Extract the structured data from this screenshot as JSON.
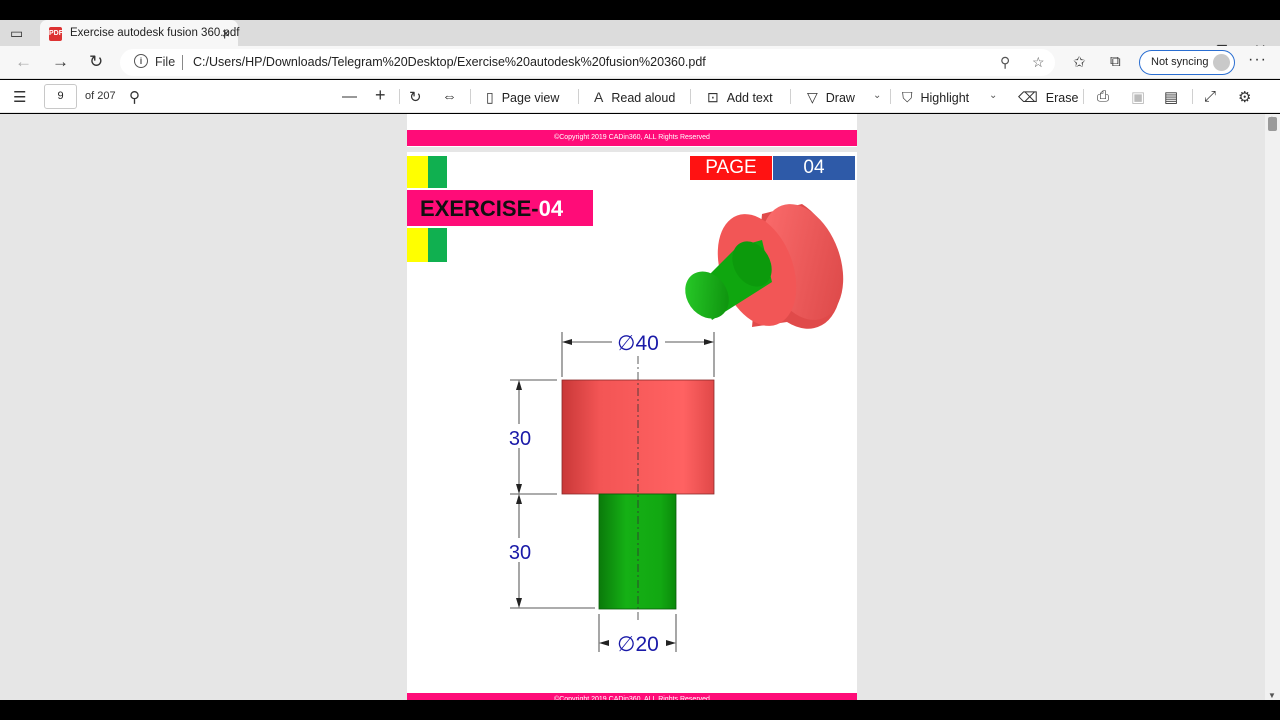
{
  "browser": {
    "tab_title": "Exercise autodesk fusion 360.pdf",
    "tab_favicon": "PDF",
    "file_label": "File",
    "url": "C:/Users/HP/Downloads/Telegram%20Desktop/Exercise%20autodesk%20fusion%20360.pdf",
    "sync_label": "Not syncing"
  },
  "pdf_toolbar": {
    "page_number": "9",
    "page_total": "of 207",
    "page_view": "Page view",
    "read_aloud": "Read aloud",
    "add_text": "Add text",
    "draw": "Draw",
    "highlight": "Highlight",
    "erase": "Erase"
  },
  "document": {
    "copyright": "©Copyright 2019 CADin360, ALL Rights Reserved",
    "page_label": "PAGE",
    "page_number": "04",
    "exercise_word": "EXERCISE-",
    "exercise_number": "04",
    "dim_top_diameter": "∅40",
    "dim_upper_height": "30",
    "dim_lower_height": "30",
    "dim_bottom_diameter": "∅20"
  },
  "colors": {
    "magenta": "#ff0c78",
    "red_part": "#f35555",
    "green_part": "#10a010",
    "dimension_text": "#1a1aa8",
    "page_red": "#ff1212",
    "page_blue": "#2e5aa8"
  }
}
